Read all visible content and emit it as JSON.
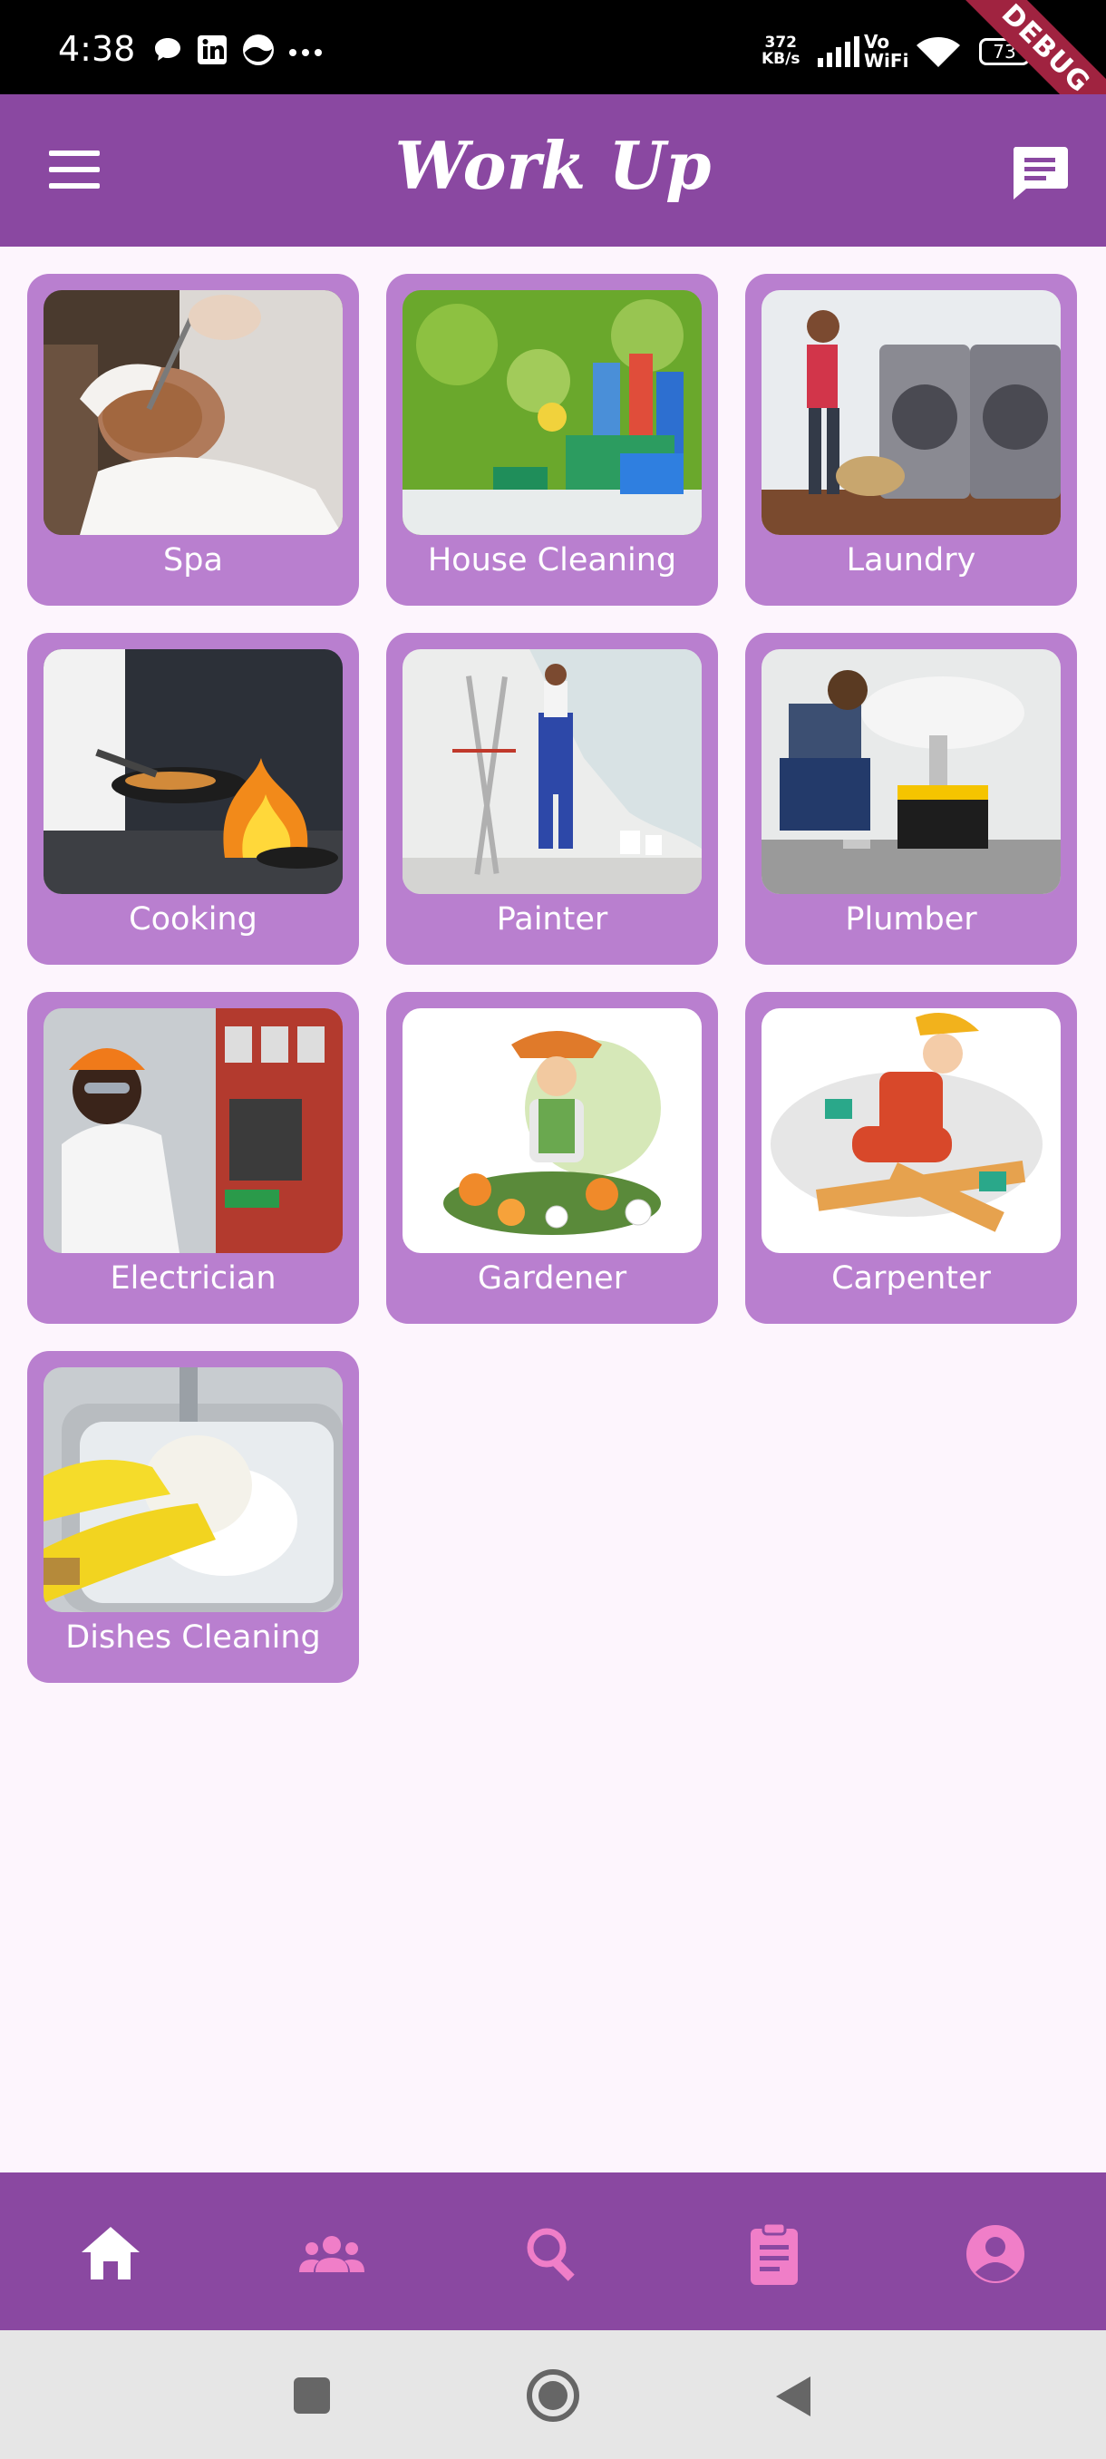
{
  "status_bar": {
    "time": "4:38",
    "speed_value": "372",
    "speed_unit": "KB/s",
    "vo": "Vo",
    "wifi_label": "WiFi",
    "battery": "73",
    "debug_label": "DEBUG"
  },
  "app_bar": {
    "title": "Work Up"
  },
  "services": [
    {
      "label": "Spa",
      "icon": "spa-photo"
    },
    {
      "label": "House Cleaning",
      "icon": "cleaning-supplies-photo"
    },
    {
      "label": "Laundry",
      "icon": "laundry-photo"
    },
    {
      "label": "Cooking",
      "icon": "cooking-photo"
    },
    {
      "label": "Painter",
      "icon": "painter-photo"
    },
    {
      "label": "Plumber",
      "icon": "plumber-photo"
    },
    {
      "label": "Electrician",
      "icon": "electrician-photo"
    },
    {
      "label": "Gardener",
      "icon": "gardener-illustration"
    },
    {
      "label": "Carpenter",
      "icon": "carpenter-illustration"
    },
    {
      "label": "Dishes Cleaning",
      "icon": "dishes-photo"
    }
  ],
  "bottom_nav": [
    {
      "name": "home",
      "icon": "home-icon",
      "active": true
    },
    {
      "name": "people",
      "icon": "people-icon",
      "active": false
    },
    {
      "name": "search",
      "icon": "search-icon",
      "active": false
    },
    {
      "name": "orders",
      "icon": "clipboard-icon",
      "active": false
    },
    {
      "name": "profile",
      "icon": "account-icon",
      "active": false
    }
  ],
  "colors": {
    "primary": "#8a48a1",
    "card": "#b97fcf",
    "background": "#fdf5fd",
    "nav_inactive": "#f07ec8",
    "nav_active": "#ffffff"
  }
}
